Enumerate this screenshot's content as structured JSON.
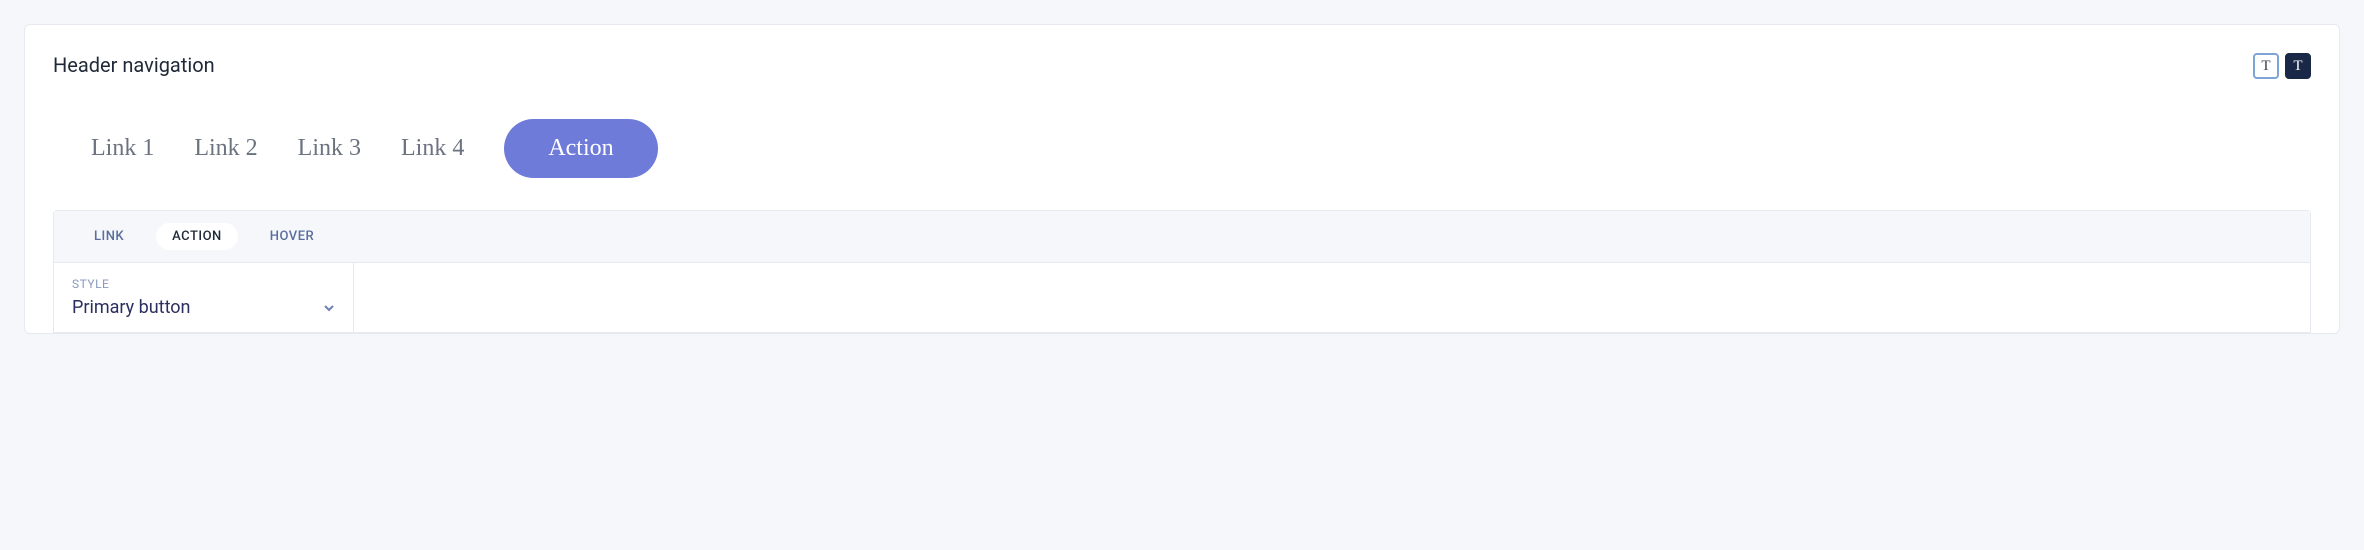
{
  "panel": {
    "title": "Header navigation"
  },
  "theme": {
    "light_glyph": "T",
    "dark_glyph": "T"
  },
  "nav": {
    "links": [
      "Link 1",
      "Link 2",
      "Link 3",
      "Link 4"
    ],
    "action_label": "Action"
  },
  "config": {
    "tabs": {
      "link": "LINK",
      "action": "ACTION",
      "hover": "HOVER"
    },
    "style": {
      "label": "STYLE",
      "value": "Primary button"
    }
  }
}
